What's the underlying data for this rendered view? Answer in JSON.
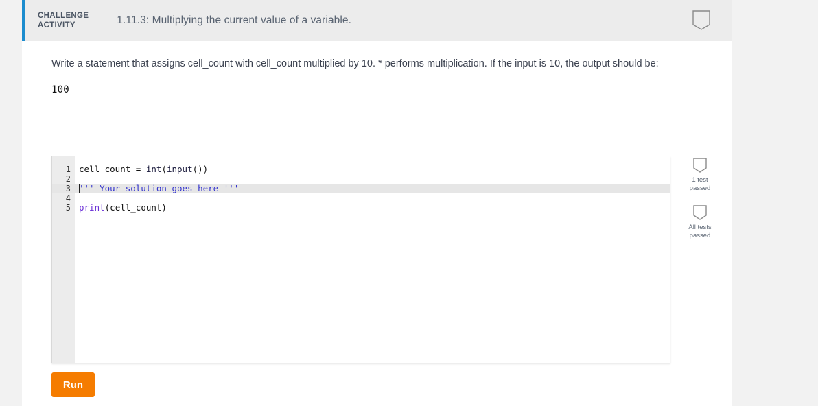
{
  "header": {
    "activity_label": "CHALLENGE\nACTIVITY",
    "title": "1.11.3: Multiplying the current value of a variable.",
    "badge_icon": "shield-badge-icon",
    "accent_color": "#1c8cce",
    "background": "#ececec"
  },
  "content": {
    "prompt": "Write a statement that assigns cell_count with cell_count multiplied by 10. * performs multiplication. If the input is 10, the output should be:",
    "sample_output": "100"
  },
  "editor": {
    "lines": [
      {
        "number": "1",
        "tokens": [
          {
            "text": "cell_count ",
            "type": "plain"
          },
          {
            "text": "= ",
            "type": "plain"
          },
          {
            "text": "int",
            "type": "fn"
          },
          {
            "text": "(",
            "type": "plain"
          },
          {
            "text": "input",
            "type": "fn"
          },
          {
            "text": "())",
            "type": "plain"
          }
        ],
        "active": false,
        "caret": false
      },
      {
        "number": "2",
        "tokens": [],
        "active": false,
        "caret": false
      },
      {
        "number": "3",
        "tokens": [
          {
            "text": "''' Your solution goes here '''",
            "type": "str"
          }
        ],
        "active": true,
        "caret": true
      },
      {
        "number": "4",
        "tokens": [],
        "active": false,
        "caret": false
      },
      {
        "number": "5",
        "tokens": [
          {
            "text": "print",
            "type": "kw"
          },
          {
            "text": "(cell_count)",
            "type": "plain"
          }
        ],
        "active": false,
        "caret": false
      }
    ]
  },
  "tests": [
    {
      "icon": "shield-badge-icon",
      "label": "1 test\npassed"
    },
    {
      "icon": "shield-badge-icon",
      "label": "All tests\npassed"
    }
  ],
  "actions": {
    "run_label": "Run",
    "run_color": "#f57c00"
  }
}
